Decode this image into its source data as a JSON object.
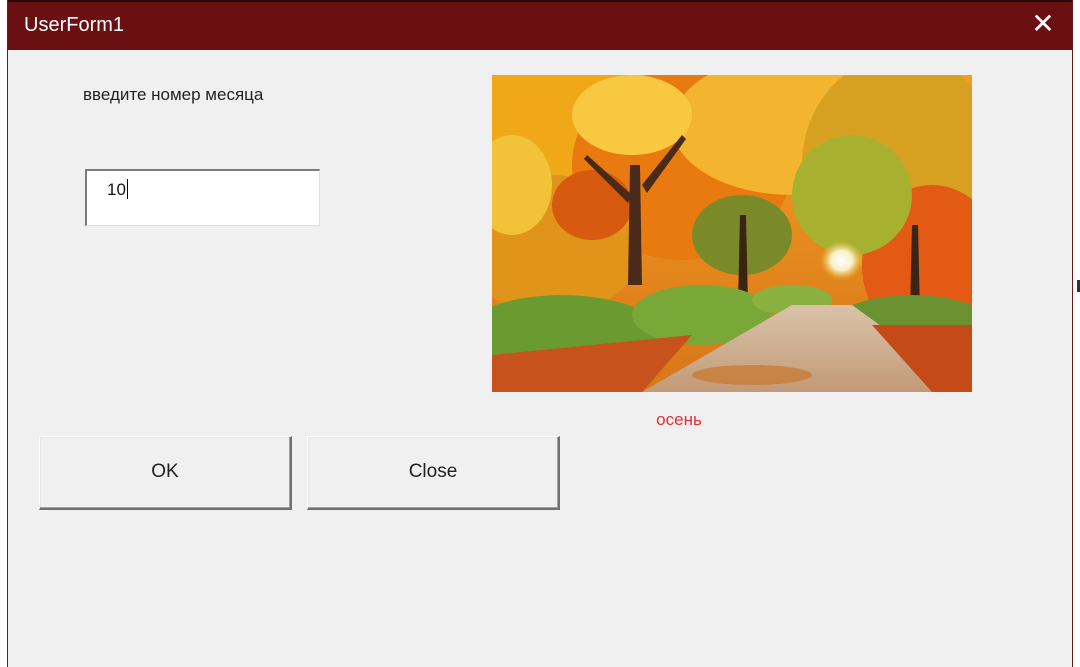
{
  "window": {
    "title": "UserForm1",
    "close_glyph": "✕",
    "titlebar_color": "#6b1012"
  },
  "form": {
    "prompt_label": "введите номер месяца",
    "month_input_value": "10",
    "season_label": "осень",
    "season_label_color": "#e03131",
    "image_icon": "autumn-forest-road-image"
  },
  "buttons": {
    "ok_label": "OK",
    "close_label": "Close"
  }
}
